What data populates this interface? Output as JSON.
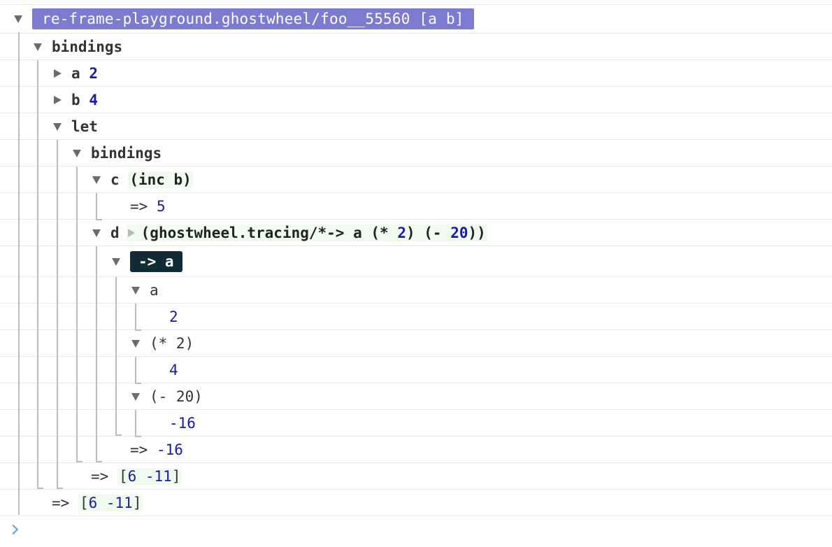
{
  "header": {
    "title": "re-frame-playground.ghostwheel/foo__55560 [a b]"
  },
  "tree": {
    "bindings_label": "bindings",
    "a": {
      "key": "a",
      "value": "2"
    },
    "b": {
      "key": "b",
      "value": "4"
    },
    "let_label": "let",
    "inner_bindings_label": "bindings",
    "c": {
      "key": "c",
      "form": "(inc b)",
      "result_arrow": "=>",
      "result": "5"
    },
    "d": {
      "key": "d",
      "form_prefix": "(ghostwheel.tracing/*-> a (* ",
      "form_n1": "2",
      "form_mid": ") (- ",
      "form_n2": "20",
      "form_suffix": "))",
      "thread_badge": "-> a",
      "steps": [
        {
          "expr": "a",
          "value": "2"
        },
        {
          "expr": "(* 2)",
          "value": "4"
        },
        {
          "expr": "(- 20)",
          "value": "-16"
        }
      ],
      "result_arrow": "=>",
      "result": "-16"
    },
    "let_result_arrow": "=>",
    "let_result_open": "[",
    "let_result_values": "6 -11",
    "let_result_close": "]",
    "fn_result_arrow": "=>",
    "fn_result_open": "[",
    "fn_result_values": "6 -11",
    "fn_result_close": "]"
  },
  "colors": {
    "header_badge": "#7b7bd0",
    "arrow_badge": "#112c35",
    "number": "#1a1aa6",
    "form_bg": "#f0fbf0",
    "prompt": "#4aa3f0"
  },
  "icons": {
    "expanded": "triangle-down",
    "collapsed": "triangle-right",
    "prompt": "chevron-right"
  }
}
